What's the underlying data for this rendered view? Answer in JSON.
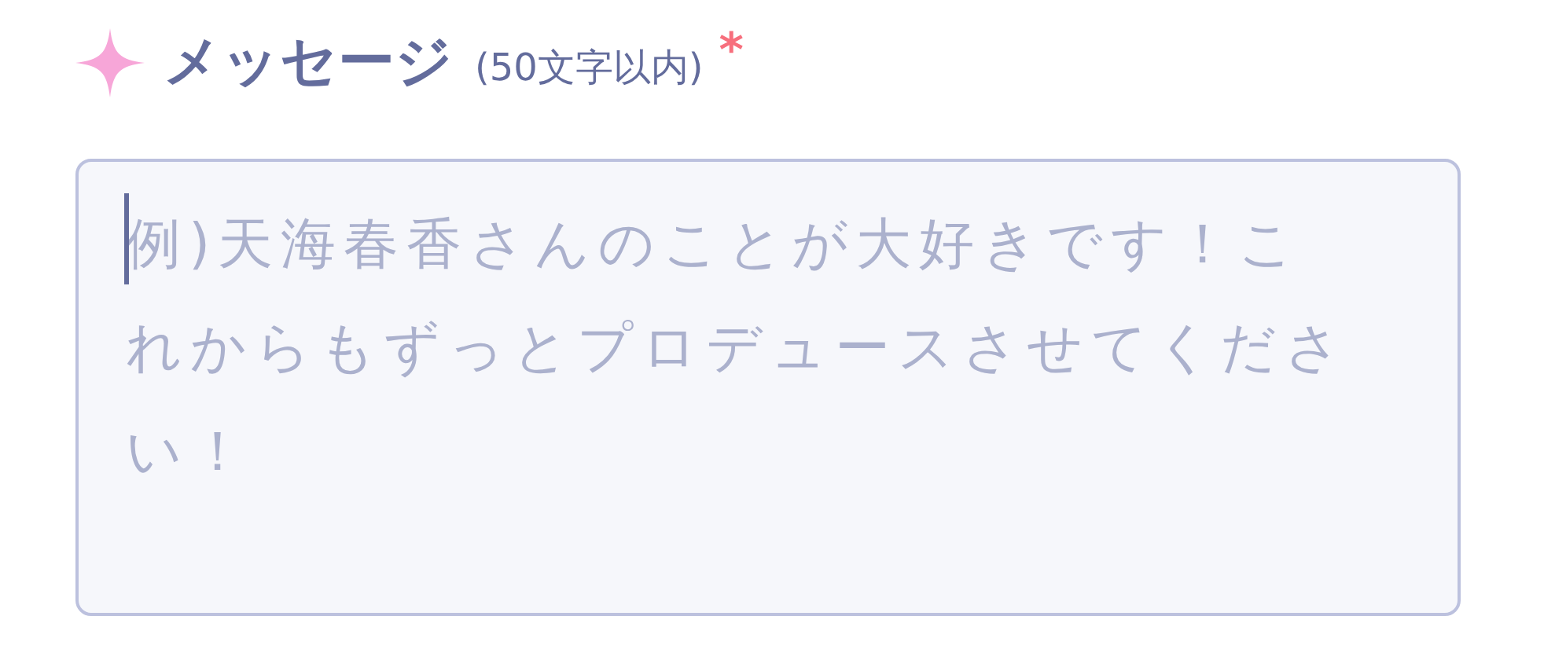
{
  "field": {
    "label": "メッセージ",
    "hint": "(50文字以内)",
    "required_mark": "*",
    "placeholder": "例)天海春香さんのことが大好きです！これからもずっとプロデュースさせてください！"
  }
}
